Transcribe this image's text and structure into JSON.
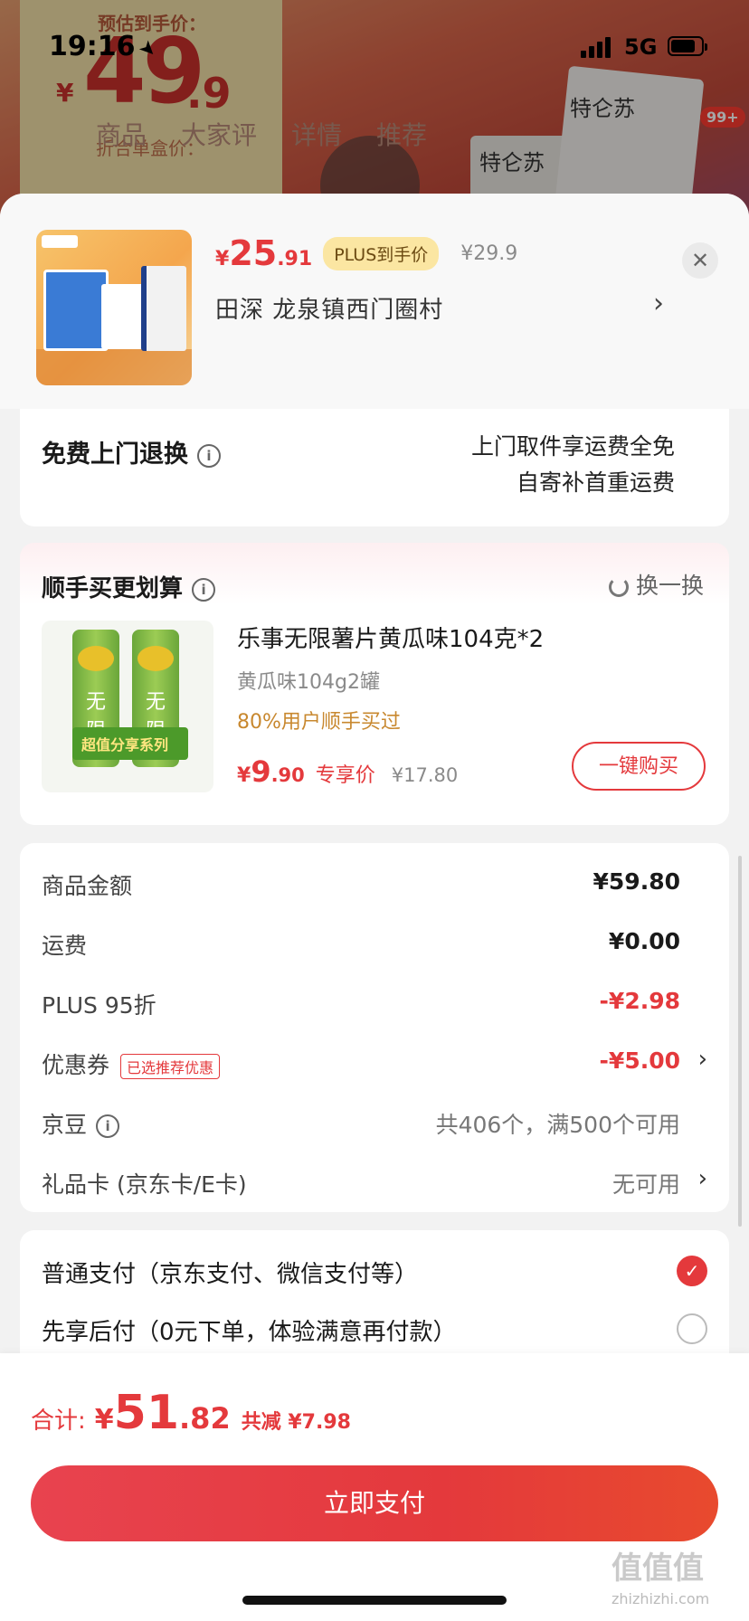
{
  "status_bar": {
    "time": "19:16",
    "network": "5G"
  },
  "background_page": {
    "estimate_label": "预估到手价：",
    "yen": "¥",
    "price_int": "49",
    "price_dec": ".9",
    "sub_label": "折合单盒价：",
    "tabs": [
      "商品",
      "大家评",
      "详情",
      "推荐"
    ],
    "cart_badge": "99+",
    "brand": "特仑苏"
  },
  "product_header": {
    "price_yen": "¥",
    "price_int": "25",
    "price_dec": ".91",
    "plus_tag": "PLUS到手价",
    "original_price": "¥29.9",
    "address": "田深  龙泉镇西门圈村"
  },
  "return_service": {
    "title": "免费上门退换",
    "line1": "上门取件享运费全免",
    "line2": "自寄补首重运费"
  },
  "bundle": {
    "title": "顺手买更划算",
    "swap_label": "换一换",
    "item_name": "乐事无限薯片黄瓜味104克*2",
    "item_spec": "黄瓜味104g2罐",
    "bought_rate": "80%用户顺手买过",
    "price_yen": "¥",
    "price_int": "9",
    "price_dec": ".90",
    "exclusive_label": "专享价",
    "original_price": "¥17.80",
    "buy_button": "一键购买",
    "package_text": "超值分享系列",
    "can_label": "无限"
  },
  "summary": {
    "rows": [
      {
        "label": "商品金额",
        "value": "¥59.80"
      },
      {
        "label": "运费",
        "value": "¥0.00"
      },
      {
        "label": "PLUS 95折",
        "value": "-¥2.98"
      },
      {
        "label": "优惠券",
        "tag": "已选推荐优惠",
        "value": "-¥5.00"
      },
      {
        "label": "京豆",
        "value": "共406个，满500个可用"
      },
      {
        "label": "礼品卡 (京东卡/E卡)",
        "value": "无可用"
      }
    ]
  },
  "payment": {
    "option1": "普通支付（京东支付、微信支付等）",
    "option2": "先享后付（0元下单，体验满意再付款）"
  },
  "footer": {
    "total_label": "合计:",
    "total_yen": "¥",
    "total_int": "51",
    "total_dec": ".82",
    "saved": "共减 ¥7.98",
    "pay_button": "立即支付"
  },
  "watermark": {
    "logo": "值值值",
    "site": "zhizhizhi.com"
  },
  "colors": {
    "accent_red": "#e4393c",
    "plus_gold": "#fbe6a2",
    "bought_orange": "#c8882f"
  }
}
